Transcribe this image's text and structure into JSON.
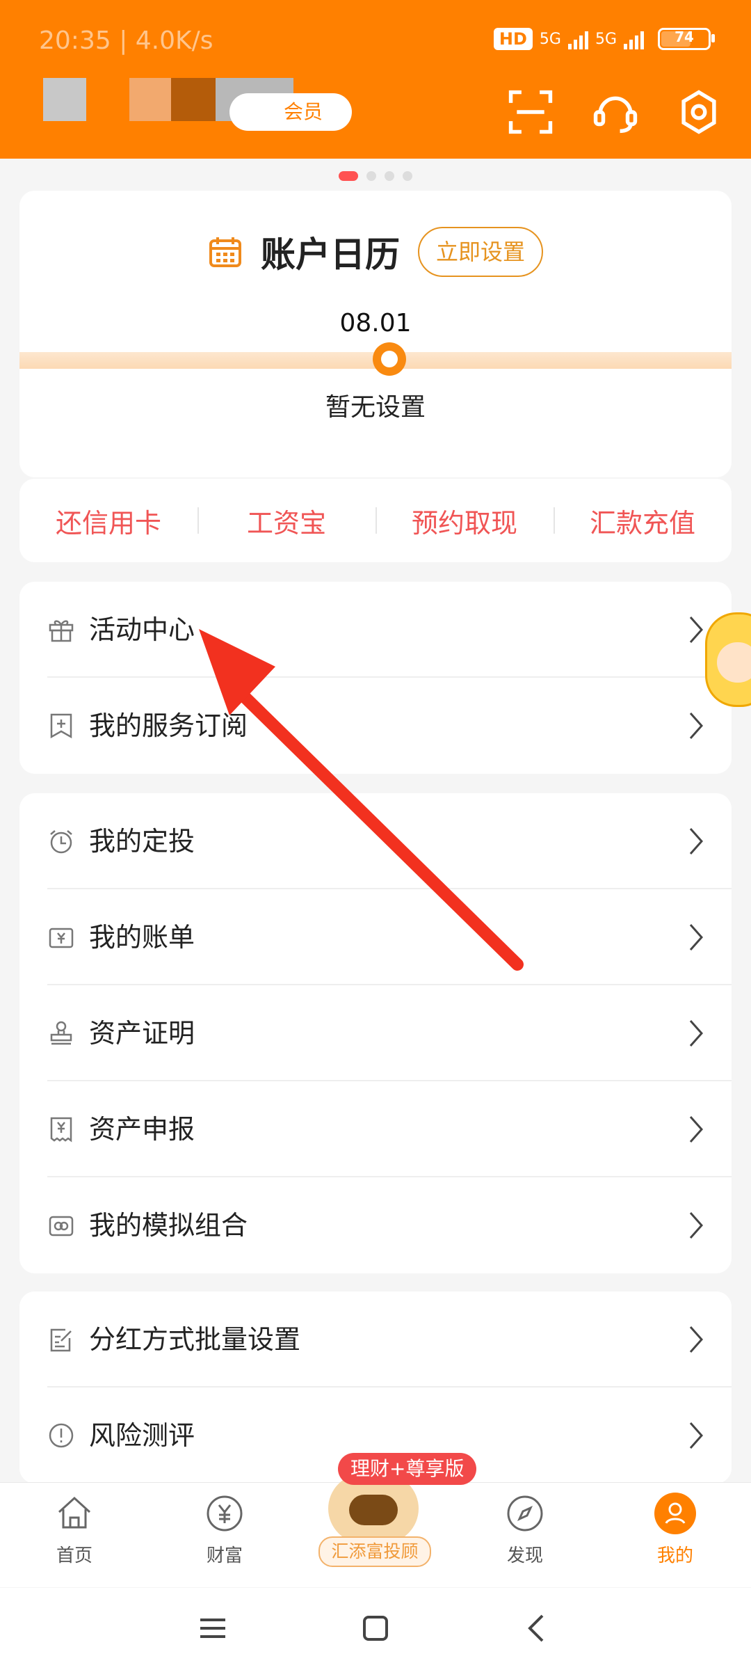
{
  "status_bar": {
    "time": "20:35 | 4.0K/s",
    "hd": "HD",
    "net1": "5G",
    "net2": "5G",
    "battery": "74"
  },
  "header": {
    "vip_label": "会员",
    "icons": [
      "scan-icon",
      "headset-icon",
      "settings-icon"
    ]
  },
  "calendar": {
    "title": "账户日历",
    "set_button": "立即设置",
    "date": "08.01",
    "status": "暂无设置"
  },
  "shortcuts": [
    "还信用卡",
    "工资宝",
    "预约取现",
    "汇款充值"
  ],
  "menu_group_1": [
    {
      "label": "活动中心",
      "icon": "gift-icon"
    },
    {
      "label": "我的服务订阅",
      "icon": "bookmark-plus-icon"
    }
  ],
  "menu_group_2": [
    {
      "label": "我的定投",
      "icon": "alarm-clock-icon"
    },
    {
      "label": "我的账单",
      "icon": "bill-icon"
    },
    {
      "label": "资产证明",
      "icon": "stamp-icon"
    },
    {
      "label": "资产申报",
      "icon": "receipt-icon"
    },
    {
      "label": "我的模拟组合",
      "icon": "simulation-icon"
    }
  ],
  "menu_group_3": [
    {
      "label": "分红方式批量设置",
      "icon": "edit-doc-icon"
    },
    {
      "label": "风险测评",
      "icon": "warning-circle-icon"
    }
  ],
  "bottom_nav": {
    "promo_tag": "理财+尊享版",
    "items": [
      {
        "label": "首页",
        "icon": "home-icon"
      },
      {
        "label": "财富",
        "icon": "wealth-icon"
      },
      {
        "label": "汇添富投顾",
        "icon": "robot-icon"
      },
      {
        "label": "发现",
        "icon": "compass-icon"
      },
      {
        "label": "我的",
        "icon": "user-icon",
        "active": true
      }
    ]
  },
  "colors": {
    "brand_orange": "#ff8000",
    "shortcut_red": "#f05555",
    "arrow_red": "#f2311f"
  }
}
